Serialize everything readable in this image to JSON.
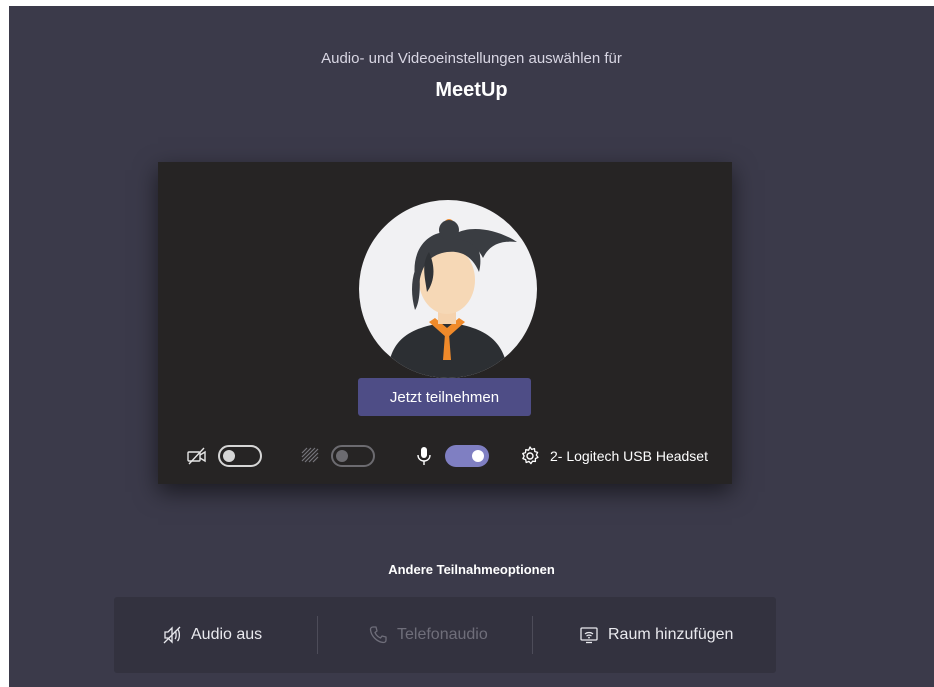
{
  "header": {
    "subtitle": "Audio- und Videoeinstellungen auswählen für",
    "meeting_title": "MeetUp"
  },
  "preview": {
    "join_button_label": "Jetzt teilnehmen"
  },
  "controls": {
    "camera": {
      "icon": "camera-off-icon",
      "state": "off"
    },
    "background_blur": {
      "icon": "background-blur-icon",
      "state": "off",
      "enabled": false
    },
    "microphone": {
      "icon": "microphone-icon",
      "state": "on"
    },
    "device": {
      "icon": "gear-icon",
      "label": "2- Logitech USB Headset"
    }
  },
  "other_options": {
    "title": "Andere Teilnahmeoptionen",
    "items": [
      {
        "icon": "speaker-off-icon",
        "label": "Audio aus",
        "enabled": true
      },
      {
        "icon": "phone-icon",
        "label": "Telefonaudio",
        "enabled": false
      },
      {
        "icon": "room-cast-icon",
        "label": "Raum hinzufügen",
        "enabled": true
      }
    ]
  },
  "colors": {
    "background": "#3b3a4a",
    "preview_background": "#262424",
    "accent": "#4e4d86",
    "toggle_on": "#7f7fc2",
    "options_background": "#33323f"
  }
}
